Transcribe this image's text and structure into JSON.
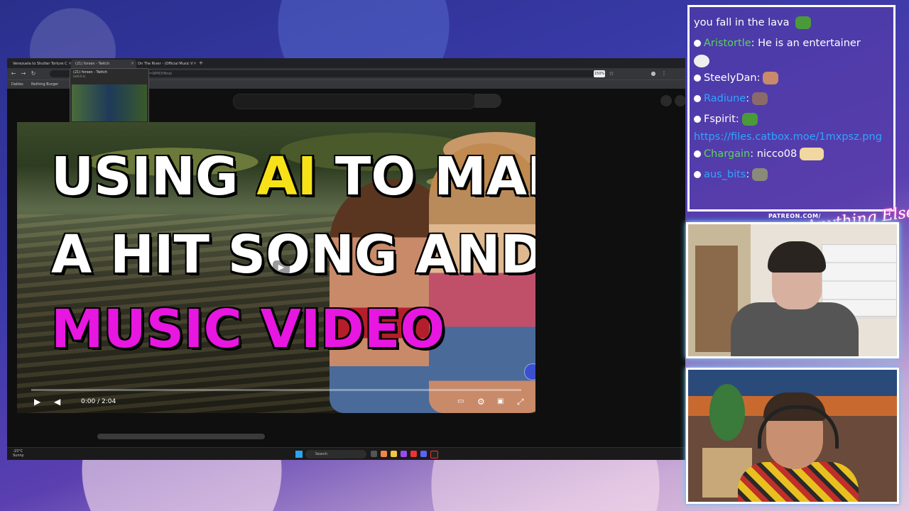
{
  "browser": {
    "tabs": [
      {
        "label": "Venezuela to Shutter Torture C"
      },
      {
        "label": "(21) forsen - Twitch"
      },
      {
        "label": "On The River - (Official Music V"
      }
    ],
    "url_fragment": "=WP83tNnql",
    "zoom": "150%",
    "bookmarks": [
      "Dailies",
      "Nothing Burger"
    ],
    "tab_preview": {
      "title": "(21) forsen - Twitch",
      "subtitle": "twitch.tv"
    }
  },
  "video": {
    "headline": {
      "line1_a": "USING ",
      "line1_hl": "AI",
      "line1_b": " TO MAKE",
      "line2": "A HIT SONG AND",
      "line3": "MUSIC VIDEO"
    },
    "time": "0:00 / 2:04",
    "progress": 0
  },
  "taskbar": {
    "weather_temp": "-15°C",
    "weather_desc": "Sunny",
    "search_placeholder": "Search"
  },
  "chat": {
    "messages": [
      {
        "user": "",
        "text": "you fall in the lava"
      },
      {
        "user": "Aristortle",
        "text": "He is an entertainer",
        "color": "green"
      },
      {
        "user": "SteelyDan",
        "text": "",
        "color": "white"
      },
      {
        "user": "Radiune",
        "text": "",
        "color": "blue"
      },
      {
        "user": "Fspirit",
        "text": "",
        "color": "white"
      },
      {
        "user": "",
        "text": "https://files.catbox.moe/1mxpsz.png"
      },
      {
        "user": "Chargain",
        "text": "nicco08",
        "color": "green"
      },
      {
        "user": "aus_bits",
        "text": "",
        "color": "blue"
      }
    ]
  },
  "overlay": {
    "patreon": "PATREON.COM/",
    "logo": "Anything Else?"
  },
  "colors": {
    "headline_yellow": "#f7e21a",
    "headline_magenta": "#e716e0",
    "chat_green": "#5bd35b",
    "chat_blue": "#2ea6ff"
  }
}
